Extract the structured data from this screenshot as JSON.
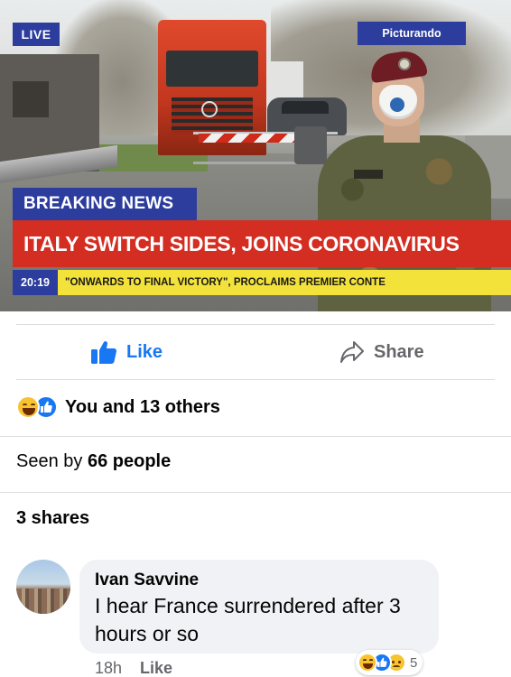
{
  "news_image": {
    "live_label": "LIVE",
    "source_label": "Picturando",
    "breaking_label": "BREAKING NEWS",
    "headline": "ITALY SWITCH SIDES, JOINS CORONAVIRUS",
    "ticker_time": "20:19",
    "ticker_text": "\"ONWARDS TO FINAL VICTORY\", PROCLAIMS PREMIER CONTE"
  },
  "actions": {
    "like_label": "Like",
    "share_label": "Share"
  },
  "reactions": {
    "icons": [
      "haha-icon",
      "like-icon"
    ],
    "summary": "You and 13 others"
  },
  "seen": {
    "prefix": "Seen by",
    "count_text": "66 people"
  },
  "shares": {
    "text": "3 shares"
  },
  "comment": {
    "author": "Ivan Savvine",
    "text": "I hear France surrendered after 3 hours or so",
    "time": "18h",
    "like_label": "Like",
    "reaction_icons": [
      "haha-icon",
      "like-icon",
      "sad-icon"
    ],
    "reaction_count": "5"
  },
  "colors": {
    "facebook_blue": "#1877f2",
    "news_blue": "#2c3d9e",
    "news_red": "#d42d22",
    "news_yellow": "#f3e23a",
    "secondary_text": "#65676b",
    "bubble_bg": "#f0f2f5"
  }
}
